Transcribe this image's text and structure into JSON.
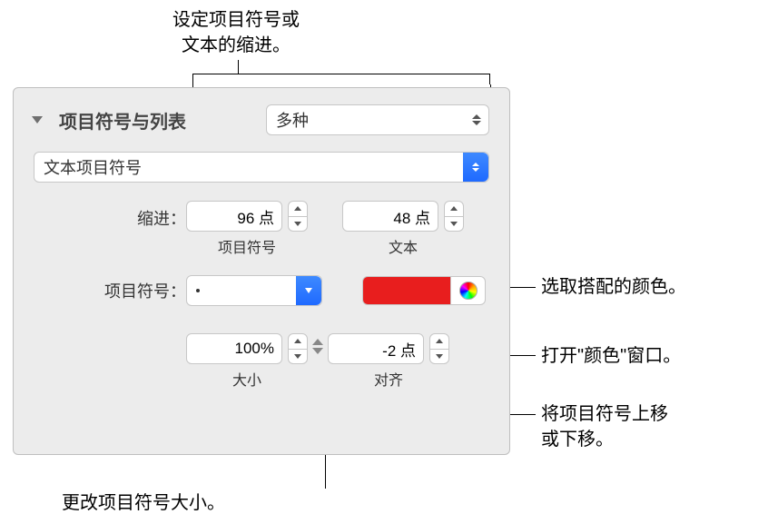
{
  "callouts": {
    "indent": "设定项目符号或\n文本的缩进。",
    "color_pick": "选取搭配的颜色。",
    "color_window": "打开\"颜色\"窗口。",
    "move_bullet": "将项目符号上移\n或下移。",
    "size": "更改项目符号大小。"
  },
  "panel": {
    "section_title": "项目符号与列表",
    "style_select": "多种",
    "bullet_type_select": "文本项目符号",
    "indent_label": "缩进：",
    "indent_bullet_value": "96 点",
    "indent_bullet_sublabel": "项目符号",
    "indent_text_value": "48 点",
    "indent_text_sublabel": "文本",
    "bullet_label": "项目符号：",
    "bullet_char_select": "•",
    "bullet_color": "#e81e1e",
    "size_value": "100%",
    "size_sublabel": "大小",
    "align_value": "-2 点",
    "align_sublabel": "对齐"
  }
}
